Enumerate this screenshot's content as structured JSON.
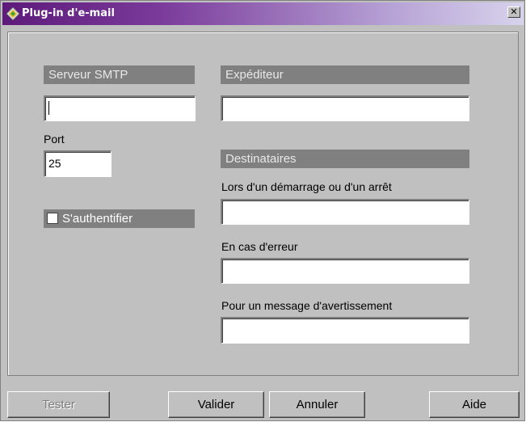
{
  "window": {
    "title": "Plug-in d'e-mail",
    "close_glyph": "✕",
    "icon": "plugin-diamond-icon"
  },
  "smtp": {
    "header": "Serveur SMTP",
    "server_value": "",
    "port_label": "Port",
    "port_value": "25",
    "auth_label": "S'authentifier",
    "auth_checked": false
  },
  "sender": {
    "header": "Expéditeur",
    "value": ""
  },
  "recipients": {
    "header": "Destinataires",
    "on_start_stop_label": "Lors d'un démarrage ou d'un arrêt",
    "on_start_stop_value": "",
    "on_error_label": "En cas d'erreur",
    "on_error_value": "",
    "on_warning_label": "Pour un message d'avertissement",
    "on_warning_value": ""
  },
  "buttons": {
    "test": "Tester",
    "validate": "Valider",
    "cancel": "Annuler",
    "help": "Aide"
  },
  "colors": {
    "title_gradient_start": "#5d1a7a",
    "title_gradient_end": "#d8d3ec",
    "header_bg": "#808080",
    "window_bg": "#c0c0c0"
  }
}
